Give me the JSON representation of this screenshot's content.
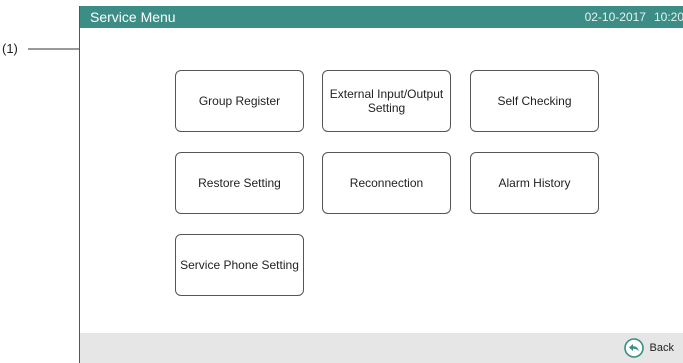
{
  "callout": {
    "label": "(1)"
  },
  "titlebar": {
    "title": "Service Menu",
    "date": "02-10-2017",
    "time": "10:20"
  },
  "menu": {
    "items": [
      {
        "label": "Group Register"
      },
      {
        "label": "External Input/Output Setting"
      },
      {
        "label": "Self Checking"
      },
      {
        "label": "Restore Setting"
      },
      {
        "label": "Reconnection"
      },
      {
        "label": "Alarm History"
      },
      {
        "label": "Service Phone Setting"
      }
    ]
  },
  "footer": {
    "back_label": "Back",
    "back_icon": "back-arrow-icon"
  },
  "colors": {
    "titlebar": "#3b8d85",
    "footer": "#e6e6e6",
    "back_icon": "#3b8d85"
  }
}
